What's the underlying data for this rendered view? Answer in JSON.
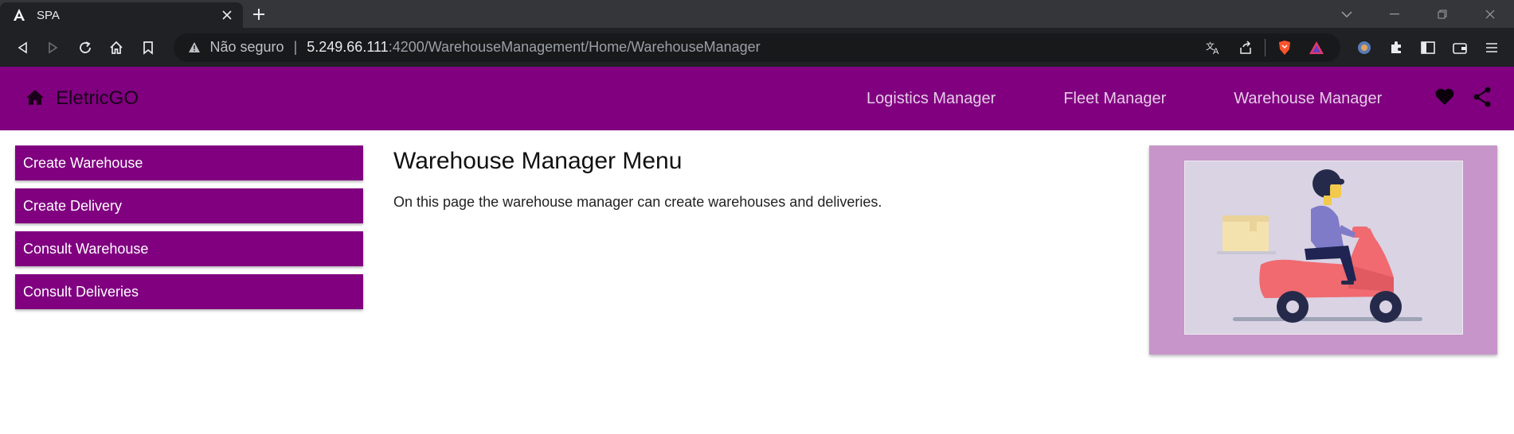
{
  "browser": {
    "tab": {
      "title": "SPA"
    },
    "address": {
      "security_label": "Não seguro",
      "separator": "|",
      "host": "5.249.66.111",
      "path": ":4200/WarehouseManagement/Home/WarehouseManager"
    }
  },
  "app": {
    "brand": {
      "name": "EletricGO",
      "icon": "home-icon"
    },
    "nav": {
      "links": [
        {
          "label": "Logistics Manager"
        },
        {
          "label": "Fleet Manager"
        },
        {
          "label": "Warehouse Manager"
        }
      ],
      "icons": [
        "heart-icon",
        "share-icon"
      ]
    },
    "sidebar": {
      "items": [
        {
          "label": "Create Warehouse"
        },
        {
          "label": "Create Delivery"
        },
        {
          "label": "Consult Warehouse"
        },
        {
          "label": "Consult Deliveries"
        }
      ]
    },
    "main": {
      "title": "Warehouse Manager Menu",
      "description": "On this page the warehouse manager can create warehouses and deliveries."
    },
    "illustration": {
      "subject": "delivery-scooter-illustration"
    }
  },
  "colors": {
    "navbar": "#800080",
    "menu_button": "#800080",
    "illustration_frame": "#c795c9",
    "illustration_bg": "#d9d3e4"
  }
}
